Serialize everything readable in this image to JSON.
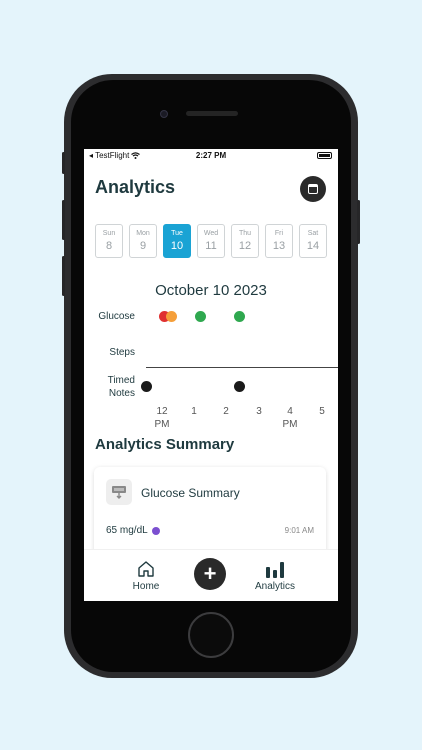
{
  "status_bar": {
    "carrier": "◂ TestFlight",
    "time": "2:27 PM"
  },
  "header": {
    "title": "Analytics",
    "calendar_icon": "calendar-icon"
  },
  "week": [
    {
      "name": "Sun",
      "date": "8"
    },
    {
      "name": "Mon",
      "date": "9"
    },
    {
      "name": "Tue",
      "date": "10",
      "active": true
    },
    {
      "name": "Wed",
      "date": "11"
    },
    {
      "name": "Thu",
      "date": "12"
    },
    {
      "name": "Fri",
      "date": "13"
    },
    {
      "name": "Sat",
      "date": "14"
    }
  ],
  "selected_date": "October 10 2023",
  "timeline": {
    "rows": {
      "glucose": "Glucose",
      "steps": "Steps",
      "timed_notes_1": "Timed",
      "timed_notes_2": "Notes"
    },
    "ticks": [
      {
        "value": "12",
        "period": "PM"
      },
      {
        "value": "1"
      },
      {
        "value": "2"
      },
      {
        "value": "3"
      },
      {
        "value": "4",
        "period": "PM"
      },
      {
        "value": "5"
      }
    ],
    "colors": {
      "red": "#e03131",
      "orange": "#f59f3a",
      "green": "#2fa84f",
      "black": "#1a1a1a"
    }
  },
  "summary": {
    "title": "Analytics Summary",
    "card": {
      "title": "Glucose Summary",
      "value": "65 mg/dL",
      "time": "9:01 AM",
      "indicator_color": "#7b4fd0"
    }
  },
  "tabs": {
    "home": "Home",
    "add": "+",
    "analytics": "Analytics"
  }
}
